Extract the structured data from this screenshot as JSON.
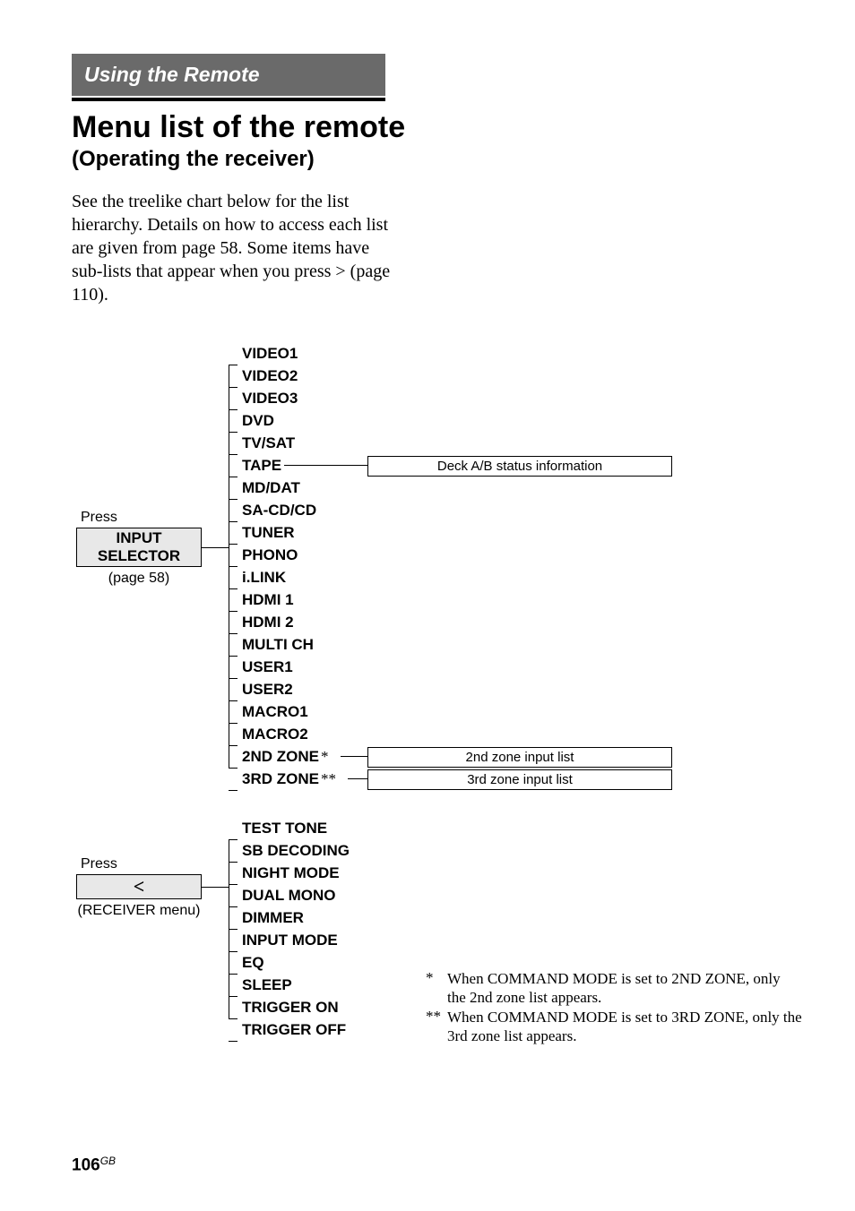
{
  "header": {
    "section": "Using the Remote",
    "title": "Menu list of the remote",
    "subtitle": "(Operating the receiver)"
  },
  "intro": "See the treelike chart below for the list hierarchy. Details on how to access each list are given from page 58. Some items have sub-lists that appear when you press > (page 110).",
  "tree1": {
    "press": "Press",
    "button_line1": "INPUT",
    "button_line2": "SELECTOR",
    "page_ref": "(page 58)",
    "items": [
      "VIDEO1",
      "VIDEO2",
      "VIDEO3",
      "DVD",
      "TV/SAT",
      "TAPE",
      "MD/DAT",
      "SA-CD/CD",
      "TUNER",
      "PHONO",
      "i.LINK",
      "HDMI 1",
      "HDMI 2",
      "MULTI CH",
      "USER1",
      "USER2",
      "MACRO1",
      "MACRO2",
      "2ND ZONE",
      "3RD ZONE"
    ],
    "marks": {
      "18": "*",
      "19": "**"
    },
    "stubs": {
      "tape": "Deck A/B status information",
      "zone2": "2nd zone input list",
      "zone3": "3rd zone input list"
    }
  },
  "tree2": {
    "press": "Press",
    "button": "<",
    "page_ref": "(RECEIVER menu)",
    "items": [
      "TEST TONE",
      "SB DECODING",
      "NIGHT MODE",
      "DUAL MONO",
      "DIMMER",
      "INPUT MODE",
      "EQ",
      "SLEEP",
      "TRIGGER ON",
      "TRIGGER OFF"
    ]
  },
  "footnotes": {
    "f1_mark": "*",
    "f1_text": "When COMMAND MODE is set to 2ND ZONE, only the 2nd zone list appears.",
    "f2_mark": "**",
    "f2_text": "When COMMAND MODE is set to 3RD ZONE, only the 3rd zone list appears."
  },
  "page_number": {
    "num": "106",
    "region": "GB"
  }
}
